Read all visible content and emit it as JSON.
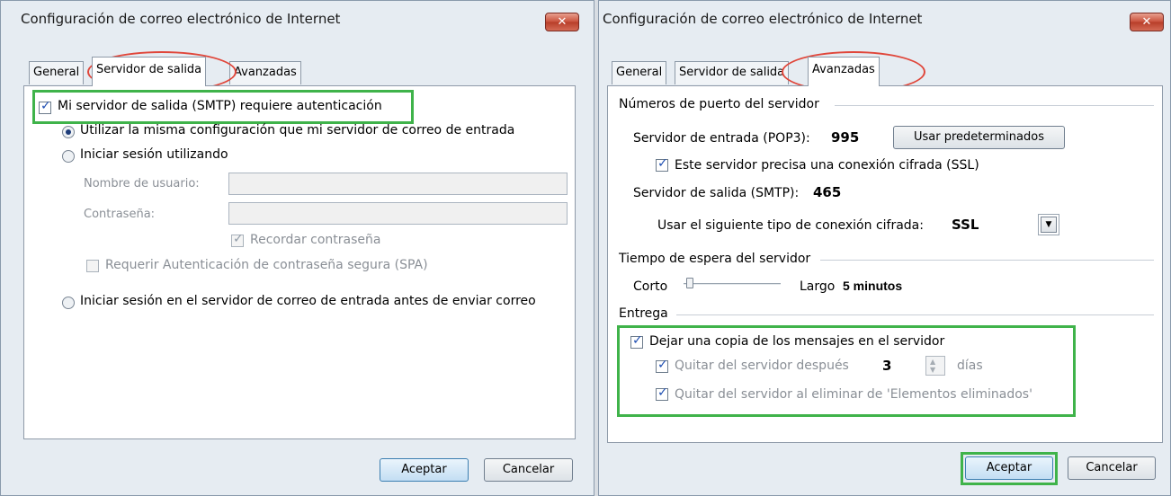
{
  "left_dialog": {
    "title": "Configuración de correo electrónico de Internet",
    "close_symbol": "✕",
    "tabs": [
      "General",
      "Servidor de salida",
      "Avanzadas"
    ],
    "active_tab": "Servidor de salida",
    "smtp_auth_label": "Mi servidor de salida (SMTP) requiere autenticación",
    "smtp_auth_checked": true,
    "radio_same_config": "Utilizar la misma configuración que mi servidor de correo de entrada",
    "radio_login_using": "Iniciar sesión utilizando",
    "username_label": "Nombre de usuario:",
    "username_value": "",
    "password_label": "Contraseña:",
    "password_value": "",
    "remember_password": "Recordar contraseña",
    "require_spa": "Requerir Autenticación de contraseña segura (SPA)",
    "radio_login_incoming": "Iniciar sesión en el servidor de correo de entrada antes de enviar correo",
    "ok_button": "Aceptar",
    "cancel_button": "Cancelar"
  },
  "right_dialog": {
    "title": "Configuración de correo electrónico de Internet",
    "close_symbol": "✕",
    "tabs": [
      "General",
      "Servidor de salida",
      "Avanzadas"
    ],
    "active_tab": "Avanzadas",
    "ports_group": "Números de puerto del servidor",
    "incoming_label": "Servidor de entrada (POP3):",
    "incoming_port": "995",
    "use_defaults_button": "Usar predeterminados",
    "ssl_required_label": "Este servidor precisa una conexión cifrada (SSL)",
    "outgoing_label": "Servidor de salida (SMTP):",
    "outgoing_port": "465",
    "encryption_label": "Usar el siguiente tipo de conexión cifrada:",
    "encryption_value": "SSL",
    "timeout_group": "Tiempo de espera del servidor",
    "timeout_short": "Corto",
    "timeout_long": "Largo",
    "timeout_value": "5 minutos",
    "timeout_level": 0.03,
    "delivery_group": "Entrega",
    "leave_copy_label": "Dejar una copia de los mensajes en el servidor",
    "remove_after_label": "Quitar del servidor después",
    "remove_after_days": "3",
    "days_label": "días",
    "remove_deleted_label": "Quitar del servidor al eliminar de 'Elementos eliminados'",
    "ok_button": "Aceptar",
    "cancel_button": "Cancelar"
  },
  "colors": {
    "highlight_green": "#3fb34a",
    "highlight_red": "#e0463a"
  }
}
